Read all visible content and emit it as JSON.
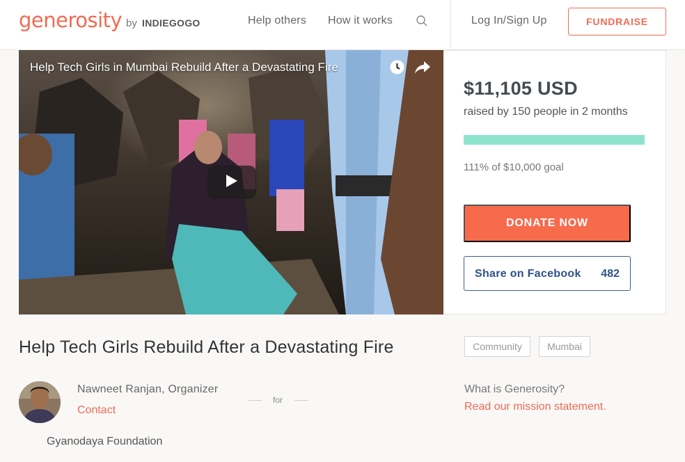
{
  "header": {
    "logo": "generosity",
    "logo_by": "by",
    "logo_brand": "INDIEGOGO",
    "nav": {
      "help_others": "Help others",
      "how_it_works": "How it works",
      "login": "Log In/Sign Up"
    },
    "fundraise_label": "FUNDRAISE",
    "search_icon": "search-icon"
  },
  "video": {
    "title": "Help Tech Girls in Mumbai Rebuild After a Devastating Fire",
    "icons": [
      "clock-icon",
      "share-arrow-icon",
      "play-icon"
    ]
  },
  "campaign": {
    "amount": "$11,105 USD",
    "raised_by": "raised by 150 people in 2 months",
    "progress_percent": 111,
    "goal_text": "111% of $10,000 goal",
    "donate_label": "DONATE NOW",
    "facebook_label": "Share on Facebook",
    "facebook_count": "482",
    "title": "Help Tech Girls Rebuild After a Devastating Fire",
    "tags": [
      "Community",
      "Mumbai"
    ]
  },
  "organizer": {
    "name": "Nawneet Ranjan, Organizer",
    "contact_label": "Contact",
    "for_label": "for",
    "beneficiary": "Gyanodaya Foundation"
  },
  "about": {
    "question": "What is Generosity?",
    "link": "Read our mission statement."
  },
  "colors": {
    "brand": "#f26a52",
    "donate": "#f76a4c",
    "progress": "#8ee3cf",
    "facebook": "#2f5189"
  }
}
